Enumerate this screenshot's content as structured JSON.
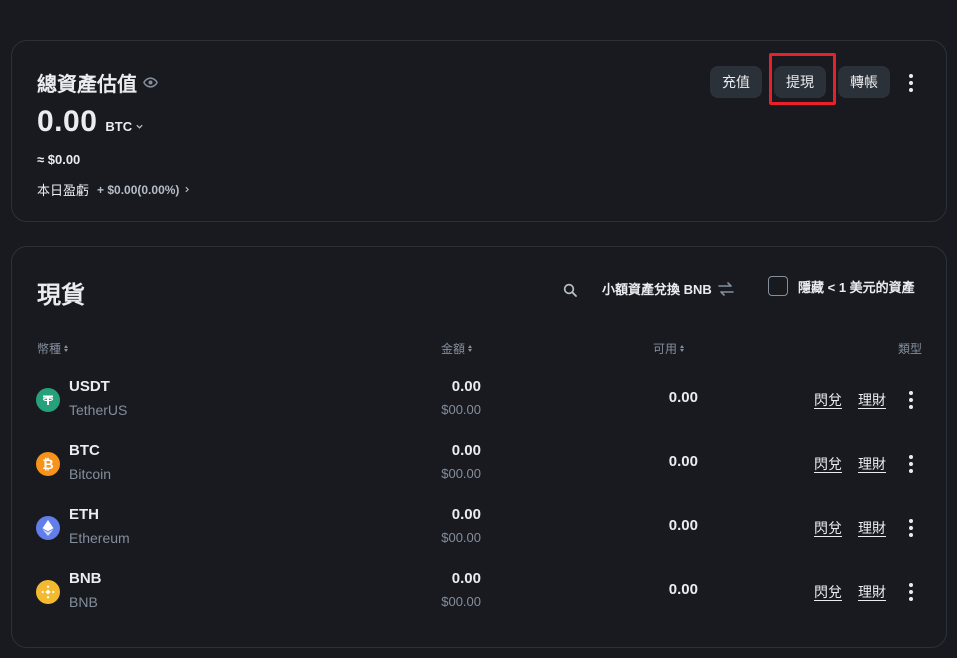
{
  "overview": {
    "title": "總資產估值",
    "amount": "0.00",
    "unit": "BTC",
    "usd_estimate": "≈ $0.00",
    "pnl_label": "本日盈虧",
    "pnl_value": "+ $0.00(0.00%)",
    "buttons": {
      "deposit": "充值",
      "withdraw": "提現",
      "transfer": "轉帳"
    }
  },
  "spot": {
    "title": "現貨",
    "convert_label": "小額資產兌換 BNB",
    "hide_label": "隱藏 < 1 美元的資產",
    "columns": {
      "coin": "幣種",
      "amount": "金額",
      "available": "可用",
      "type": "類型"
    },
    "rows": [
      {
        "symbol": "USDT",
        "name": "TetherUS",
        "amount": "0.00",
        "amount_usd": "$00.00",
        "available": "0.00",
        "trade": "閃兌",
        "earn": "理財",
        "icon_color": "#26a17b",
        "icon": "tether-icon"
      },
      {
        "symbol": "BTC",
        "name": "Bitcoin",
        "amount": "0.00",
        "amount_usd": "$00.00",
        "available": "0.00",
        "trade": "閃兌",
        "earn": "理財",
        "icon_color": "#f7931a",
        "icon": "bitcoin-icon"
      },
      {
        "symbol": "ETH",
        "name": "Ethereum",
        "amount": "0.00",
        "amount_usd": "$00.00",
        "available": "0.00",
        "trade": "閃兌",
        "earn": "理財",
        "icon_color": "#627eea",
        "icon": "ethereum-icon"
      },
      {
        "symbol": "BNB",
        "name": "BNB",
        "amount": "0.00",
        "amount_usd": "$00.00",
        "available": "0.00",
        "trade": "閃兌",
        "earn": "理財",
        "icon_color": "#f3ba2f",
        "icon": "bnb-icon"
      }
    ]
  },
  "colors": {
    "background": "#181a20",
    "card_border": "#2b3139",
    "button_bg": "#2b3139",
    "highlight": "#e8202a",
    "muted_text": "#848e9c"
  }
}
